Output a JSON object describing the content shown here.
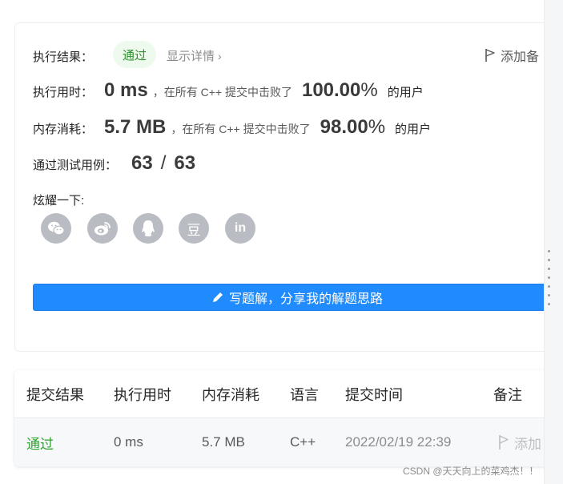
{
  "result": {
    "label": "执行结果：",
    "status": "通过",
    "detail_link": "显示详情",
    "add_note": "添加备"
  },
  "runtime": {
    "label": "执行用时：",
    "value": "0 ms",
    "desc": "，在所有 C++ 提交中击败了",
    "percent": "100.00",
    "percent_sign": "%",
    "tail": "的用户"
  },
  "memory": {
    "label": "内存消耗：",
    "value": "5.7 MB",
    "desc": "，在所有 C++ 提交中击败了",
    "percent": "98.00",
    "percent_sign": "%",
    "tail": "的用户"
  },
  "tests": {
    "label": "通过测试用例：",
    "passed": "63",
    "sep": "/",
    "total": "63"
  },
  "share": {
    "label": "炫耀一下:",
    "icons": [
      "wechat-icon",
      "weibo-icon",
      "qq-icon",
      "douban-icon",
      "linkedin-icon"
    ],
    "douban_glyph": "豆",
    "linkedin_glyph": "in"
  },
  "solution_button": "写题解，分享我的解题思路",
  "table": {
    "headers": [
      "提交结果",
      "执行用时",
      "内存消耗",
      "语言",
      "提交时间",
      "备注"
    ],
    "row": {
      "status": "通过",
      "runtime": "0 ms",
      "memory": "5.7 MB",
      "language": "C++",
      "time": "2022/02/19 22:39",
      "note": "添加"
    }
  },
  "watermark": "CSDN @天天向上的菜鸡杰！！",
  "colors": {
    "accent_blue": "#1f8bff",
    "success_green": "#2ea52e",
    "badge_bg": "#eefaee",
    "share_icon_bg": "#b9bcc2"
  }
}
